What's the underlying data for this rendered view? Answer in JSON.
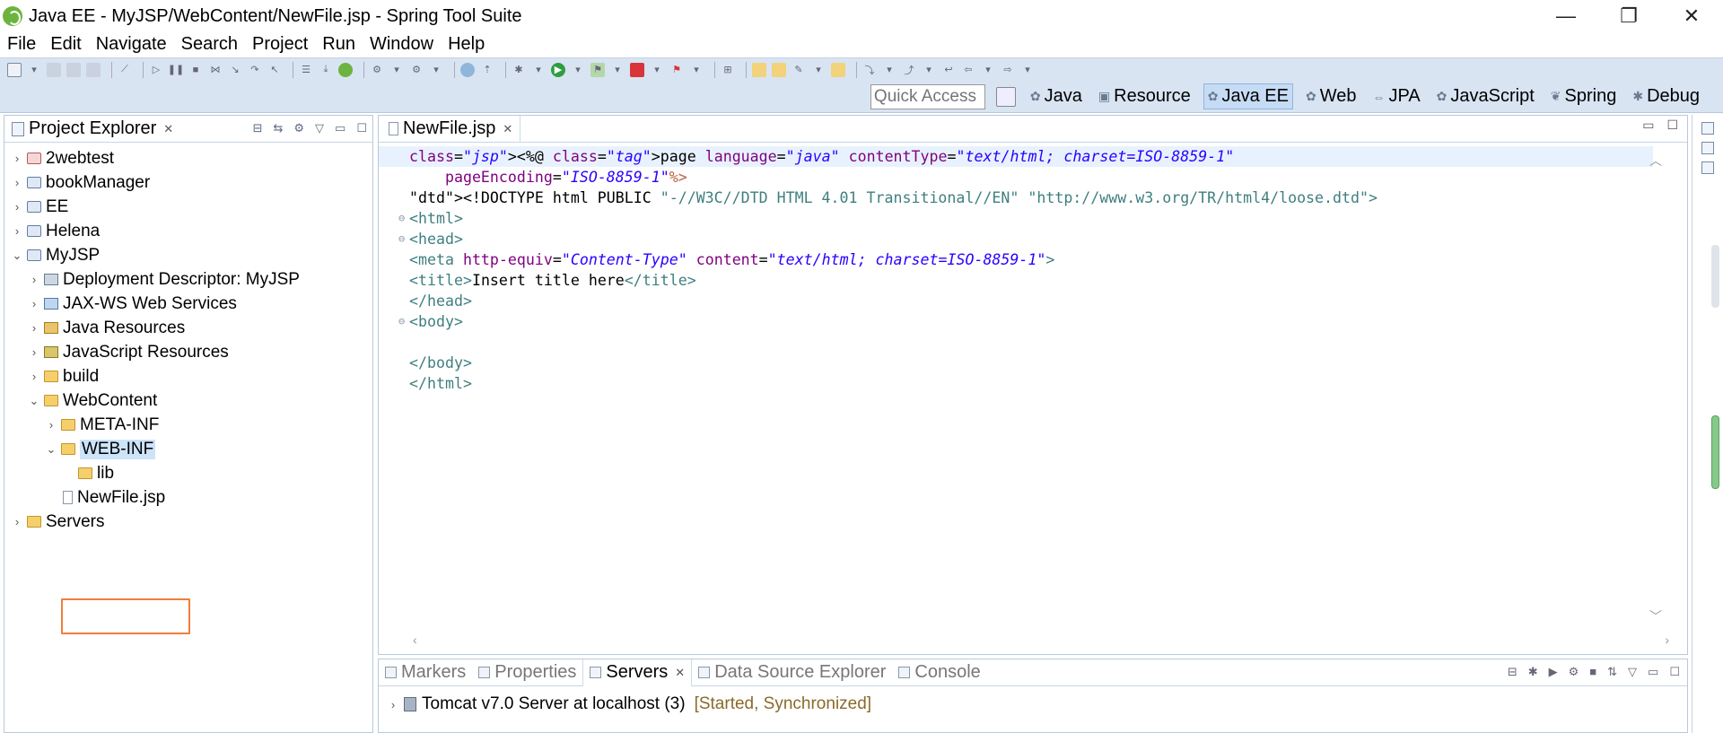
{
  "window": {
    "title": "Java EE - MyJSP/WebContent/NewFile.jsp - Spring Tool Suite",
    "minimize": "—",
    "restore": "❐",
    "close": "✕"
  },
  "menu": [
    "File",
    "Edit",
    "Navigate",
    "Search",
    "Project",
    "Run",
    "Window",
    "Help"
  ],
  "quick_access": {
    "placeholder": "Quick Access"
  },
  "perspectives": [
    {
      "label": "Java",
      "active": false
    },
    {
      "label": "Resource",
      "active": false
    },
    {
      "label": "Java EE",
      "active": true
    },
    {
      "label": "Web",
      "active": false
    },
    {
      "label": "JPA",
      "active": false
    },
    {
      "label": "JavaScript",
      "active": false
    },
    {
      "label": "Spring",
      "active": false
    },
    {
      "label": "Debug",
      "active": false
    }
  ],
  "explorer": {
    "title": "Project Explorer",
    "close": "✕",
    "tree": [
      {
        "label": "2webtest"
      },
      {
        "label": "bookManager"
      },
      {
        "label": "EE"
      },
      {
        "label": "Helena"
      },
      {
        "label": "MyJSP"
      },
      {
        "label": "Deployment Descriptor: MyJSP"
      },
      {
        "label": "JAX-WS Web Services"
      },
      {
        "label": "Java Resources"
      },
      {
        "label": "JavaScript Resources"
      },
      {
        "label": "build"
      },
      {
        "label": "WebContent"
      },
      {
        "label": "META-INF"
      },
      {
        "label": "WEB-INF"
      },
      {
        "label": "lib"
      },
      {
        "label": "NewFile.jsp"
      },
      {
        "label": "Servers"
      }
    ]
  },
  "editor": {
    "tab": "NewFile.jsp",
    "close": "✕",
    "lines": [
      "<%@ page language=\"java\" contentType=\"text/html; charset=ISO-8859-1\"",
      "    pageEncoding=\"ISO-8859-1\"%>",
      "<!DOCTYPE html PUBLIC \"-//W3C//DTD HTML 4.01 Transitional//EN\" \"http://www.w3.org/TR/html4/loose.dtd\">",
      "<html>",
      "<head>",
      "<meta http-equiv=\"Content-Type\" content=\"text/html; charset=ISO-8859-1\">",
      "<title>Insert title here</title>",
      "</head>",
      "<body>",
      "",
      "</body>",
      "</html>"
    ]
  },
  "bottom": {
    "tabs": [
      {
        "label": "Markers",
        "active": false
      },
      {
        "label": "Properties",
        "active": false
      },
      {
        "label": "Servers",
        "active": true
      },
      {
        "label": "Data Source Explorer",
        "active": false
      },
      {
        "label": "Console",
        "active": false
      }
    ],
    "close": "✕",
    "server": {
      "name": "Tomcat v7.0 Server at localhost (3)",
      "status": "[Started, Synchronized]"
    }
  }
}
